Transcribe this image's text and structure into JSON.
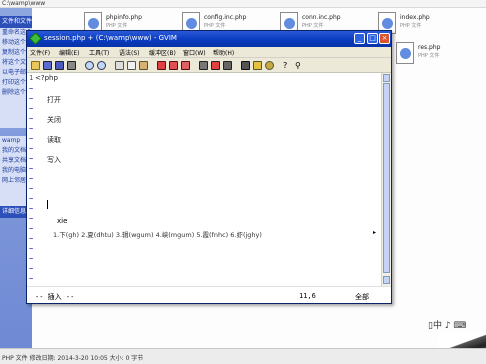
{
  "explorer": {
    "address": "C:\\wamp\\www",
    "tasks_header": "文件和文件夹任务",
    "tasks": [
      "重命名这个文件",
      "移动这个文件",
      "复制这个文件",
      "将这个文件发布到 Web",
      "以电子邮件形式发送此文件",
      "打印这个文件",
      "删除这个文件"
    ],
    "other_places": [
      "wamp",
      "我的文档",
      "共享文档",
      "我的电脑",
      "网上邻居"
    ],
    "details_header": "详细信息",
    "files": [
      {
        "name": "phpinfo.php",
        "desc": "PHP 文件"
      },
      {
        "name": "config.inc.php",
        "desc": "PHP 文件"
      },
      {
        "name": "conn.inc.php",
        "desc": "PHP 文件"
      },
      {
        "name": "index.php",
        "desc": "PHP 文件"
      },
      {
        "name": "res.php",
        "desc": "PHP 文件"
      }
    ],
    "status_text": "PHP 文件 修改日期: 2014-3-20 10:05 大小: 0 字节",
    "ime_float": "▯中 ♪ ⌨"
  },
  "gvim": {
    "title": "session.php + (C:\\wamp\\www) - GVIM",
    "menu": [
      "文件(F)",
      "编辑(E)",
      "工具(T)",
      "语法(S)",
      "缓冲区(B)",
      "窗口(W)",
      "帮助(H)"
    ],
    "toolbar_icons": [
      "open-icon",
      "save-icon",
      "save-all-icon",
      "print-icon",
      "undo-icon",
      "redo-icon",
      "cut-icon",
      "copy-icon",
      "paste-icon",
      "find-icon",
      "find-next-icon",
      "find-prev-icon",
      "load-session-icon",
      "save-session-icon",
      "run-script-icon",
      "make-icon",
      "shell-icon",
      "make-tags-icon",
      "jump-tag-icon",
      "help-icon",
      "find-help-icon"
    ],
    "lines": [
      {
        "gutter": "1",
        "text": "<?php"
      },
      {
        "gutter": "~",
        "text": ""
      },
      {
        "gutter": "~",
        "text": "  打开"
      },
      {
        "gutter": "~",
        "text": ""
      },
      {
        "gutter": "~",
        "text": "  关闭"
      },
      {
        "gutter": "~",
        "text": ""
      },
      {
        "gutter": "~",
        "text": "  读取"
      },
      {
        "gutter": "~",
        "text": ""
      },
      {
        "gutter": "~",
        "text": "  写入"
      }
    ],
    "ime": {
      "input": "xie",
      "candidates": "1.下(gh)  2.夏(dhtu)  3.辑(wgum)  4.峡(mgum)  5.霞(fnhc)  6.虾(jghy)",
      "more": "▸"
    },
    "status": {
      "mode": "-- 插入 --",
      "position": "11,6",
      "scroll": "全部"
    }
  }
}
